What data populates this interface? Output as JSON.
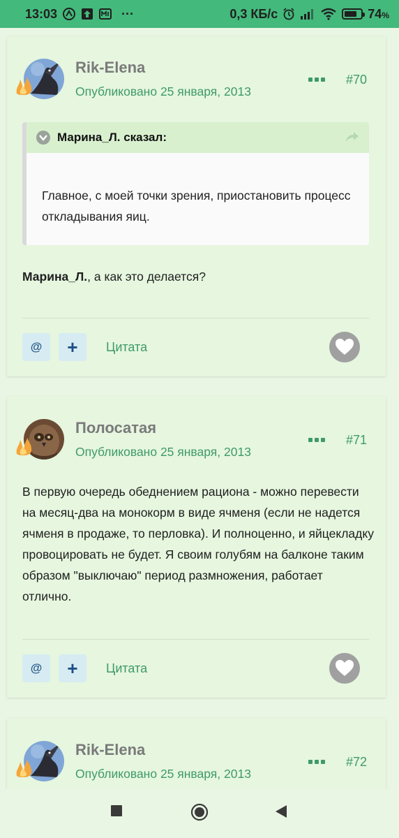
{
  "status_bar": {
    "time": "13:03",
    "dots": "···",
    "speed": "0,3 КБ/с",
    "battery": "74",
    "battery_unit": "%",
    "battery_level": 0.74
  },
  "posts": [
    {
      "author": "Rik-Elena",
      "published_prefix": "Опубликовано",
      "published_date": "25 января, 2013",
      "number": "#70",
      "quote": {
        "author": "Марина_Л. сказал:",
        "text": "Главное, с моей точки зрения, приостановить процесс откладывания яиц."
      },
      "mention": "Марина_Л.",
      "text": ", а как это делается?",
      "actions": {
        "at": "@",
        "plus": "+",
        "cite": "Цитата"
      }
    },
    {
      "author": "Полосатая",
      "published_prefix": "Опубликовано",
      "published_date": "25 января, 2013",
      "number": "#71",
      "text": "В первую очередь обеднением рациона - можно перевести на месяц-два на монокорм в виде ячменя (если не надется ячменя в продаже, то перловка). И полноценно, и яйцекладку провоцировать не будет. Я своим голубям на балконе таким образом \"выключаю\" период размножения, работает отлично.",
      "actions": {
        "at": "@",
        "plus": "+",
        "cite": "Цитата"
      }
    },
    {
      "author": "Rik-Elena",
      "published_prefix": "Опубликовано",
      "published_date": "25 января, 2013",
      "number": "#72"
    }
  ],
  "colors": {
    "status_bar": "#43b97b",
    "card_bg": "#e6f6df",
    "accent_green": "#3f9a68",
    "quote_header": "#d9f0cf"
  }
}
